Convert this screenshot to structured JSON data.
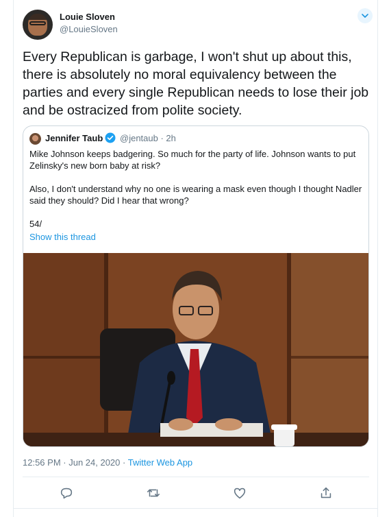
{
  "tweet": {
    "author_name": "Louie Sloven",
    "author_handle": "@LouieSloven",
    "text": "Every Republican is garbage, I won't shut up about this, there is absolutely no moral equivalency between the parties and every single Republican needs to lose their job and be ostracized from polite society.",
    "time": "12:56 PM",
    "separator": " · ",
    "date": "Jun 24, 2020",
    "source_app": "Twitter Web App"
  },
  "quoted": {
    "author_name": "Jennifer Taub",
    "author_handle": "@jentaub",
    "age": "2h",
    "paragraphs": [
      "Mike Johnson keeps badgering. So much for the party of life. Johnson wants to put Zelinsky's new born baby at risk?",
      "Also, I don't understand why no one is wearing a mask even though I thought Nadler said they should? Did I hear that wrong?",
      "54/"
    ],
    "show_thread": "Show this thread"
  },
  "actions": [
    "reply-icon",
    "retweet-icon",
    "like-icon",
    "share-icon"
  ],
  "colors": {
    "link": "#1b95e0",
    "muted": "#657786",
    "border": "#e6ecf0"
  }
}
